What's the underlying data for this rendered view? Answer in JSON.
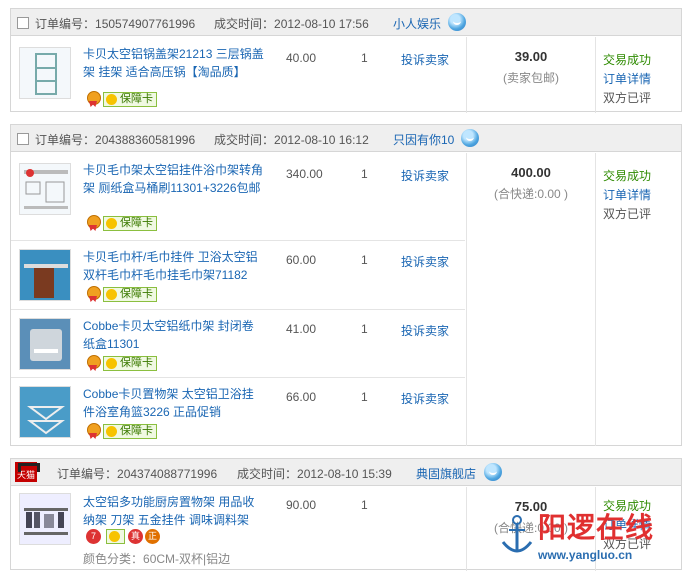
{
  "labels": {
    "order_no": "订单编号：",
    "deal_time": "成交时间：",
    "complain": "投诉卖家",
    "guarantee": "保障卡",
    "status_ok": "交易成功",
    "order_detail": "订单详情",
    "rated": "双方已评",
    "spec_label": "颜色分类：",
    "tmall": "天猫"
  },
  "orders": [
    {
      "order_no": "150574907761996",
      "time": "2012-08-10 17:56",
      "seller": "小人娱乐",
      "total": "39.00",
      "shipping": "(卖家包邮)",
      "items": [
        {
          "name": "卡贝太空铝锅盖架21213 三层锅盖架 挂架 适合高压锅【淘品质】",
          "price": "40.00",
          "qty": "1"
        }
      ]
    },
    {
      "order_no": "204388360581996",
      "time": "2012-08-10 16:12",
      "seller": "只因有你10",
      "total": "400.00",
      "shipping": "(合快递:0.00 )",
      "items": [
        {
          "name": "卡贝毛巾架太空铝挂件浴巾架转角架 厕纸盒马桶刷11301+3226包邮",
          "price": "340.00",
          "qty": "1"
        },
        {
          "name": "卡贝毛巾杆/毛巾挂件 卫浴太空铝双杆毛巾杆毛巾挂毛巾架71182",
          "price": "60.00",
          "qty": "1"
        },
        {
          "name": "Cobbe卡贝太空铝纸巾架 封闭卷纸盒11301",
          "price": "41.00",
          "qty": "1"
        },
        {
          "name": "Cobbe卡贝置物架 太空铝卫浴挂件浴室角篮3226 正品促销",
          "price": "66.00",
          "qty": "1"
        }
      ]
    },
    {
      "order_no": "204374088771996",
      "time": "2012-08-10 15:39",
      "seller": "典固旗舰店",
      "total": "75.00",
      "shipping": "(合快递:0.00 )",
      "items": [
        {
          "name": "太空铝多功能厨房置物架 用品收纳架 刀架 五金挂件 调味调料架",
          "price": "90.00",
          "qty": "1",
          "spec": "60CM-双杯|铝边"
        }
      ],
      "item_badges": [
        "7",
        "真",
        "正"
      ]
    }
  ],
  "watermark": {
    "text": "阳逻在线",
    "url": "www.yangluo.cn"
  },
  "colors": {
    "link": "#1a66b3",
    "success": "#2e8b00",
    "header_bg": "#efefef",
    "tmall": "#c40000"
  }
}
